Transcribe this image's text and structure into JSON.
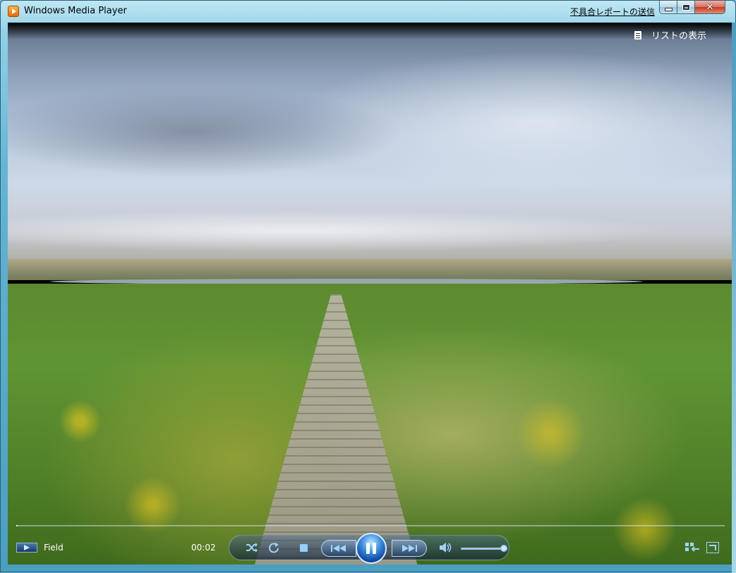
{
  "window": {
    "title": "Windows Media Player",
    "report_link": "不具合レポートの送信"
  },
  "video": {
    "list_button_label": "リストの表示"
  },
  "now_playing": {
    "title": "Field",
    "time": "00:02"
  },
  "playback": {
    "state": "playing",
    "progress": 0.002,
    "volume": 0.92
  },
  "icons": {
    "app": "media-player-icon",
    "list": "list-icon",
    "shuffle": "shuffle-icon",
    "repeat": "repeat-icon",
    "stop": "stop-icon",
    "previous": "previous-icon",
    "pause": "pause-icon",
    "next": "next-icon",
    "volume": "speaker-icon",
    "switch": "switch-to-library-icon",
    "fullscreen": "fullscreen-icon"
  },
  "colors": {
    "accent": "#3a8de0",
    "control_glyph": "#9fd4ff"
  }
}
